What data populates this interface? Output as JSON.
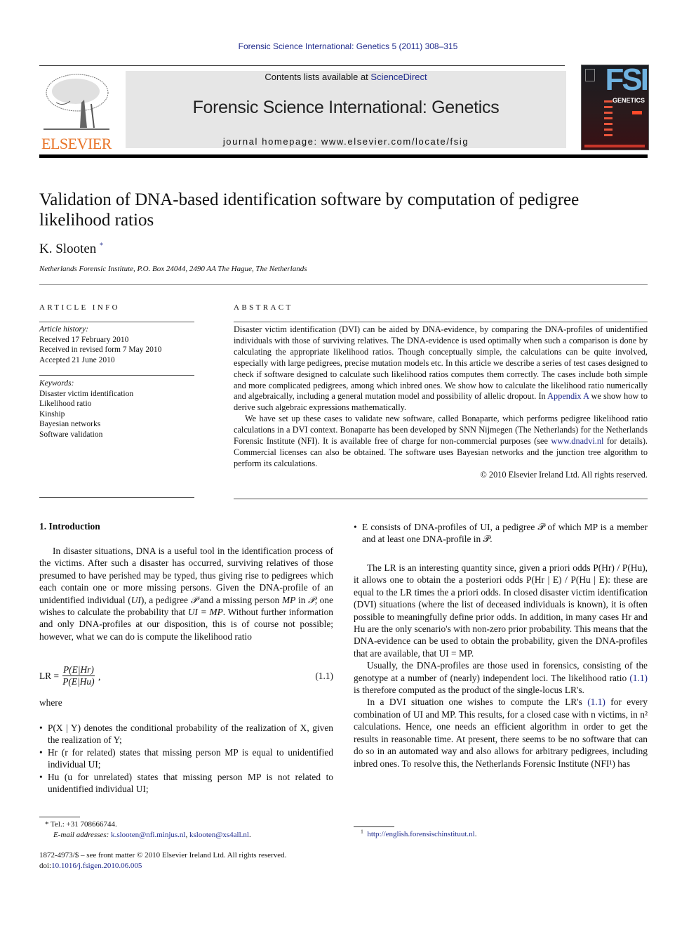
{
  "header": {
    "citation": "Forensic Science International: Genetics 5 (2011) 308–315",
    "contents_prefix": "Contents lists available at ",
    "contents_link": "ScienceDirect",
    "journal_title": "Forensic Science International: Genetics",
    "homepage": "journal homepage: www.elsevier.com/locate/fsig",
    "publisher_logo": "ELSEVIER",
    "cover": {
      "abbrev": "FSI",
      "subtitle": "GENETICS"
    }
  },
  "article": {
    "title": "Validation of DNA-based identification software by computation of pedigree likelihood ratios",
    "author": "K. Slooten",
    "author_mark": "*",
    "affiliation": "Netherlands Forensic Institute, P.O. Box 24044, 2490 AA The Hague, The Netherlands"
  },
  "article_info": {
    "heading": "ARTICLE INFO",
    "history_label": "Article history:",
    "history": [
      "Received 17 February 2010",
      "Received in revised form 7 May 2010",
      "Accepted 21 June 2010"
    ],
    "keywords_label": "Keywords:",
    "keywords": [
      "Disaster victim identification",
      "Likelihood ratio",
      "Kinship",
      "Bayesian networks",
      "Software validation"
    ]
  },
  "abstract": {
    "heading": "ABSTRACT",
    "p1_a": "Disaster victim identification (DVI) can be aided by DNA-evidence, by comparing the DNA-profiles of unidentified individuals with those of surviving relatives. The DNA-evidence is used optimally when such a comparison is done by calculating the appropriate likelihood ratios. Though conceptually simple, the calculations can be quite involved, especially with large pedigrees, precise mutation models etc. In this article we describe a series of test cases designed to check if software designed to calculate such likelihood ratios computes them correctly. The cases include both simple and more complicated pedigrees, among which inbred ones. We show how to calculate the likelihood ratio numerically and algebraically, including a general mutation model and possibility of allelic dropout. In ",
    "p1_link": "Appendix A",
    "p1_b": " we show how to derive such algebraic expressions mathematically.",
    "p2_a": "We have set up these cases to validate new software, called Bonaparte, which performs pedigree likelihood ratio calculations in a DVI context. Bonaparte has been developed by SNN Nijmegen (The Netherlands) for the Netherlands Forensic Institute (NFI). It is available free of charge for non-commercial purposes (see ",
    "p2_link": "www.dnadvi.nl",
    "p2_b": " for details). Commercial licenses can also be obtained. The software uses Bayesian networks and the junction tree algorithm to perform its calculations.",
    "copyright": "© 2010 Elsevier Ireland Ltd. All rights reserved."
  },
  "intro": {
    "heading": "1.  Introduction",
    "p1_a": "In disaster situations, DNA is a useful tool in the identification process of the victims. After such a disaster has occurred, surviving relatives of those presumed to have perished may be typed, thus giving rise to pedigrees which each contain one or more missing persons. Given the DNA-profile of an unidentified individual (",
    "p1_ui": "UI",
    "p1_b": "), a pedigree ",
    "p1_ped": "𝒫",
    "p1_c": " and a missing person ",
    "p1_mp": "MP",
    "p1_d": " in ",
    "p1_e": ", one wishes to calculate the probability that ",
    "p1_eq": "UI = MP",
    "p1_f": ". Without further information and only DNA-profiles at our disposition, this is of course not possible; however, what we can do is compute the likelihood ratio",
    "equation": {
      "lhs": "LR =",
      "numerator": "P(E|Hr)",
      "denominator": "P(E|Hu)",
      "label": "(1.1)"
    },
    "where": "where",
    "bullets_left": [
      "P(X | Y) denotes the conditional probability of the realization of X, given the realization of Y;",
      "Hr (r for related) states that missing person MP is equal to unidentified individual UI;",
      "Hu (u for unrelated) states that missing person MP is not related to unidentified individual UI;"
    ],
    "bullet_right": "E consists of DNA-profiles of UI, a pedigree 𝒫 of which MP is a member and at least one DNA-profile in 𝒫.",
    "right_p1": "The LR is an interesting quantity since, given a priori odds P(Hr) / P(Hu), it allows one to obtain the a posteriori odds P(Hr | E) / P(Hu | E): these are equal to the LR times the a priori odds. In closed disaster victim identification (DVI) situations (where the list of deceased individuals is known), it is often possible to meaningfully define prior odds. In addition, in many cases Hr and Hu are the only scenario's with non-zero prior probability. This means that the DNA-evidence can be used to obtain the probability, given the DNA-profiles that are available, that UI = MP.",
    "right_p2_a": "Usually, the DNA-profiles are those used in forensics, consisting of the genotype at a number of (nearly) independent loci. The likelihood ratio ",
    "right_p2_ref": "(1.1)",
    "right_p2_b": " is therefore computed as the product of the single-locus LR's.",
    "right_p3_a": "In a DVI situation one wishes to compute the LR's ",
    "right_p3_ref": "(1.1)",
    "right_p3_b": " for every combination of UI and MP. This results, for a closed case with n victims, in n² calculations. Hence, one needs an efficient algorithm in order to get the results in reasonable time. At present, there seems to be no software that can do so in an automated way and also allows for arbitrary pedigrees, including inbred ones. To resolve this, the Netherlands Forensic Institute (NFI¹) has"
  },
  "footnotes": {
    "tel": "* Tel.: +31 708666744.",
    "email_label": "E-mail addresses:",
    "email1": "k.slooten@nfi.minjus.nl",
    "email2": "kslooten@xs4all.nl",
    "frontmatter": "1872-4973/$ – see front matter © 2010 Elsevier Ireland Ltd. All rights reserved.",
    "doi_label": "doi:",
    "doi": "10.1016/j.fsigen.2010.06.005",
    "fn1_mark": "1",
    "fn1_url": "http://english.forensischinstituut.nl"
  }
}
